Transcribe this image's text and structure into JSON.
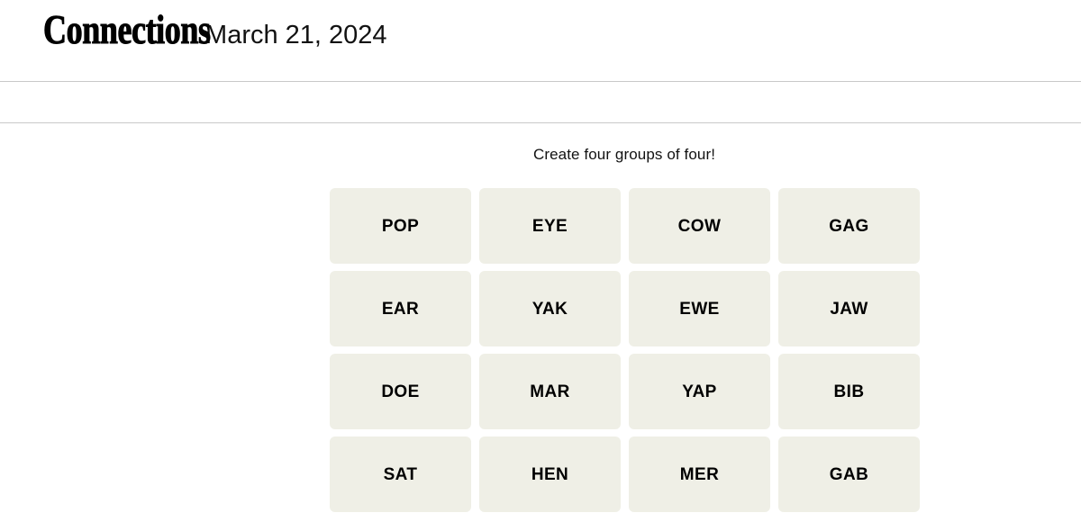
{
  "masthead": {
    "title": "Connections",
    "date": "March 21, 2024"
  },
  "toolbar": {
    "items": []
  },
  "board": {
    "instruction": "Create four groups of four!",
    "grid_columns": 4,
    "grid_rows": 4,
    "tile_color": "#EFEFE6",
    "tiles": [
      {
        "label": "POP"
      },
      {
        "label": "EYE"
      },
      {
        "label": "COW"
      },
      {
        "label": "GAG"
      },
      {
        "label": "EAR"
      },
      {
        "label": "YAK"
      },
      {
        "label": "EWE"
      },
      {
        "label": "JAW"
      },
      {
        "label": "DOE"
      },
      {
        "label": "MAR"
      },
      {
        "label": "YAP"
      },
      {
        "label": "BIB"
      },
      {
        "label": "SAT"
      },
      {
        "label": "HEN"
      },
      {
        "label": "MER"
      },
      {
        "label": "GAB"
      }
    ]
  }
}
